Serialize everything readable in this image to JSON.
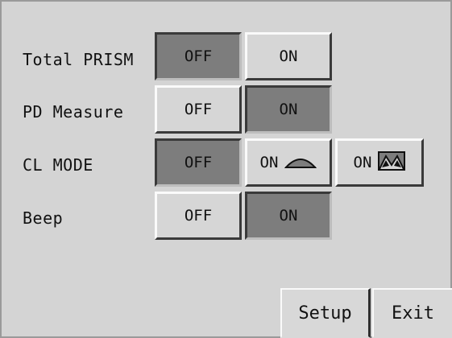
{
  "rows": [
    {
      "label": "Total PRISM",
      "off_label": "OFF",
      "on_label": "ON",
      "selected": "off"
    },
    {
      "label": "PD Measure",
      "off_label": "OFF",
      "on_label": "ON",
      "selected": "on"
    },
    {
      "label": "CL MODE",
      "off_label": "OFF",
      "on_single_label": "ON",
      "on_double_label": "ON",
      "selected": "off"
    },
    {
      "label": "Beep",
      "off_label": "OFF",
      "on_label": "ON",
      "selected": "on"
    }
  ],
  "footer": {
    "setup_label": "Setup",
    "exit_label": "Exit"
  },
  "icons": {
    "cl_single": "dome-lens-icon",
    "cl_double": "double-dome-lens-icon"
  },
  "colors": {
    "background": "#d4d4d4",
    "selected_fill": "#7d7d7d",
    "unselected_fill": "#d6d6d6"
  }
}
